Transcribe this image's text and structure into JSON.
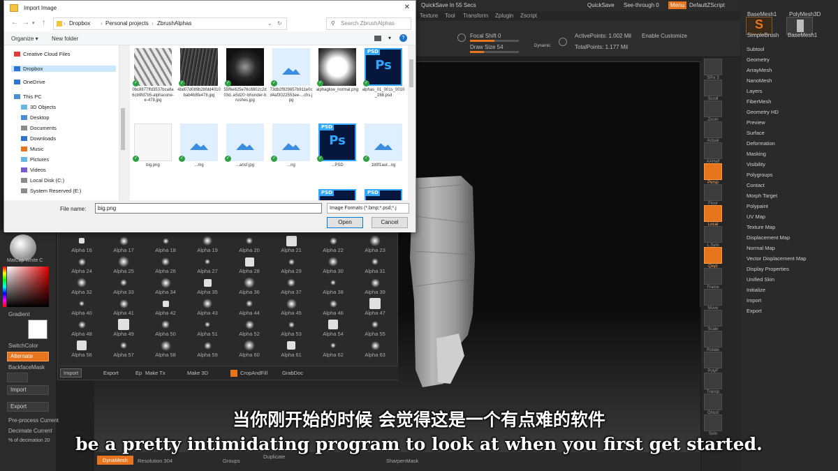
{
  "dialog": {
    "title": "Import Image",
    "close_glyph": "✕",
    "breadcrumb": [
      "Dropbox",
      "Personal projects",
      "ZbrushAlphas"
    ],
    "search_placeholder": "Search ZbrushAlphas",
    "commands": {
      "organize": "Organize ▾",
      "new_folder": "New folder"
    },
    "tree": [
      {
        "label": "Creative Cloud Files",
        "color": "#e03d3d"
      },
      {
        "label": "Dropbox",
        "color": "#2f74d0",
        "selected": true
      },
      {
        "label": "OneDrive",
        "color": "#2f74d0"
      },
      {
        "label": "This PC",
        "color": "#4b8ed1"
      },
      {
        "label": "3D Objects",
        "color": "#67b7e1"
      },
      {
        "label": "Desktop",
        "color": "#4b8ed1"
      },
      {
        "label": "Documents",
        "color": "#8a8a8a"
      },
      {
        "label": "Downloads",
        "color": "#2f74d0"
      },
      {
        "label": "Music",
        "color": "#e8741e"
      },
      {
        "label": "Pictures",
        "color": "#67b7e1"
      },
      {
        "label": "Videos",
        "color": "#7b5ad1"
      },
      {
        "label": "Local Disk (C:)",
        "color": "#8a8a8a"
      },
      {
        "label": "System Reserved (E:)",
        "color": "#8a8a8a"
      }
    ],
    "files_row1": [
      {
        "name": "0bc8877ffd3537bca8a6cb9fd7b5-alphacone-e-478.jpg",
        "kind": "zigzag"
      },
      {
        "name": "4bd07d089b2bfdd4010bab4b8fe478.jpg",
        "kind": "noise"
      },
      {
        "name": "55f6e825e76c8802c2d03d..e5d20~bhunder-brushes.jpg",
        "kind": "streaks"
      },
      {
        "name": "73db2f929857b911e0cd4af3022553ee-...chs.jpg",
        "kind": "imgicon"
      },
      {
        "name": "alphaglow_normal.png",
        "kind": "glow"
      },
      {
        "name": "alphas_01_001s_0010_288.psd",
        "kind": "psd"
      }
    ],
    "files_row2": [
      {
        "name": "big.png",
        "kind": "white"
      },
      {
        "name": "...mg",
        "kind": "imgicon"
      },
      {
        "name": "...ansf.jpg",
        "kind": "imgicon"
      },
      {
        "name": "...ng",
        "kind": "imgicon"
      },
      {
        "name": "...PSD",
        "kind": "psd"
      },
      {
        "name": "1b9f1aut...ng",
        "kind": "imgicon"
      }
    ],
    "file_name_label": "File name:",
    "file_name_value": "big.png",
    "format_value": "Image Formats (*.bmp;*.psd;*.j",
    "open_label": "Open",
    "cancel_label": "Cancel",
    "psd_label": "PSD",
    "ps_label": "Ps"
  },
  "zbrush": {
    "quicksave_status": "QuickSave In 55 Secs",
    "menu_items": [
      "QuickSave",
      "See-through 0",
      "Menu",
      "DefaultZScript"
    ],
    "menu_row2": [
      "Texture",
      "Tool",
      "Transform",
      "Zplugin",
      "Zscript"
    ],
    "toolbar": {
      "focal_shift": "Focal Shift 0",
      "draw_size": "Draw Size 54",
      "dynamic": "Dynamic",
      "active_points": "ActivePoints: 1.002 Mil",
      "total_points": "TotalPoints: 1.177 Mil",
      "enable_customize": "Enable Customize"
    },
    "tool_thumbs": [
      "BaseMesh1",
      "PolyMesh3D",
      "SimpleBrush",
      "BaseMesh1"
    ],
    "tool_list": [
      "Subtool",
      "Geometry",
      "ArrayMesh",
      "NanoMesh",
      "Layers",
      "FiberMesh",
      "Geometry HD",
      "Preview",
      "Surface",
      "Deformation",
      "Masking",
      "Visibility",
      "Polygroups",
      "Contact",
      "Morph Target",
      "Polypaint",
      "UV Map",
      "Texture Map",
      "Displacement Map",
      "Normal Map",
      "Vector Displacement Map",
      "Display Properties",
      "Unified Skin",
      "Initialize",
      "Import",
      "Export"
    ],
    "right_shelf": [
      {
        "label": "SPix 3",
        "on": false
      },
      {
        "label": "Scroll",
        "on": false
      },
      {
        "label": "Zoom",
        "on": false
      },
      {
        "label": "Actual",
        "on": false
      },
      {
        "label": "AAHalf",
        "on": false
      },
      {
        "label": "Persp",
        "on": true
      },
      {
        "label": "Floor",
        "on": false
      },
      {
        "label": "Local",
        "on": true
      },
      {
        "label": "L.Sym",
        "on": false
      },
      {
        "label": "Qxyz",
        "on": true
      },
      {
        "label": "Frame",
        "on": false
      },
      {
        "label": "Move",
        "on": false
      },
      {
        "label": "Scale",
        "on": false
      },
      {
        "label": "Rotate",
        "on": false
      },
      {
        "label": "PolyF",
        "on": false
      },
      {
        "label": "Transp",
        "on": false
      },
      {
        "label": "Ghost",
        "on": false
      },
      {
        "label": "Solo",
        "on": false
      }
    ],
    "left_panel": {
      "matcap": "MatCap White C",
      "gradient": "Gradient",
      "switch_color": "SwitchColor",
      "alternate": "Alternate",
      "backface_mask": "BackfaceMask",
      "import": "Import",
      "export": "Export",
      "preprocess": "Pre-process Current",
      "decimate": "Decimate Current",
      "decimation": "% of decimation 20"
    },
    "alpha_rows": [
      [
        "Alpha 16",
        "Alpha 17",
        "Alpha 18",
        "Alpha 19",
        "Alpha 20",
        "Alpha 21",
        "Alpha 22",
        "Alpha 23"
      ],
      [
        "Alpha 24",
        "Alpha 25",
        "Alpha 26",
        "Alpha 27",
        "Alpha 28",
        "Alpha 29",
        "Alpha 30",
        "Alpha 31"
      ],
      [
        "Alpha 32",
        "Alpha 33",
        "Alpha 34",
        "Alpha 35",
        "Alpha 36",
        "Alpha 37",
        "Alpha 38",
        "Alpha 39"
      ],
      [
        "Alpha 40",
        "Alpha 41",
        "Alpha 42",
        "Alpha 43",
        "Alpha 44",
        "Alpha 45",
        "Alpha 46",
        "Alpha 47"
      ],
      [
        "Alpha 48",
        "Alpha 49",
        "Alpha 50",
        "Alpha 51",
        "Alpha 52",
        "Alpha 53",
        "Alpha 54",
        "Alpha 55"
      ],
      [
        "Alpha 56",
        "Alpha 57",
        "Alpha 58",
        "Alpha 59",
        "Alpha 60",
        "Alpha 61",
        "Alpha 62",
        "Alpha 63"
      ]
    ],
    "alpha_bar": [
      "Import",
      "Export",
      "Ep",
      "Make Tx",
      "Make 3D",
      "CropAndFill",
      "GrabDoc"
    ],
    "bottom_bar": {
      "dynamesh": "DynaMesh",
      "resolution": "Resolution 304",
      "duplicate": "Duplicate",
      "sharpen": "SharpenMask",
      "groups": "Groups"
    }
  },
  "subtitles": {
    "cn": "当你刚开始的时候 会觉得这是一个有点难的软件",
    "en": "be a pretty intimidating program to look at when you first get started."
  }
}
